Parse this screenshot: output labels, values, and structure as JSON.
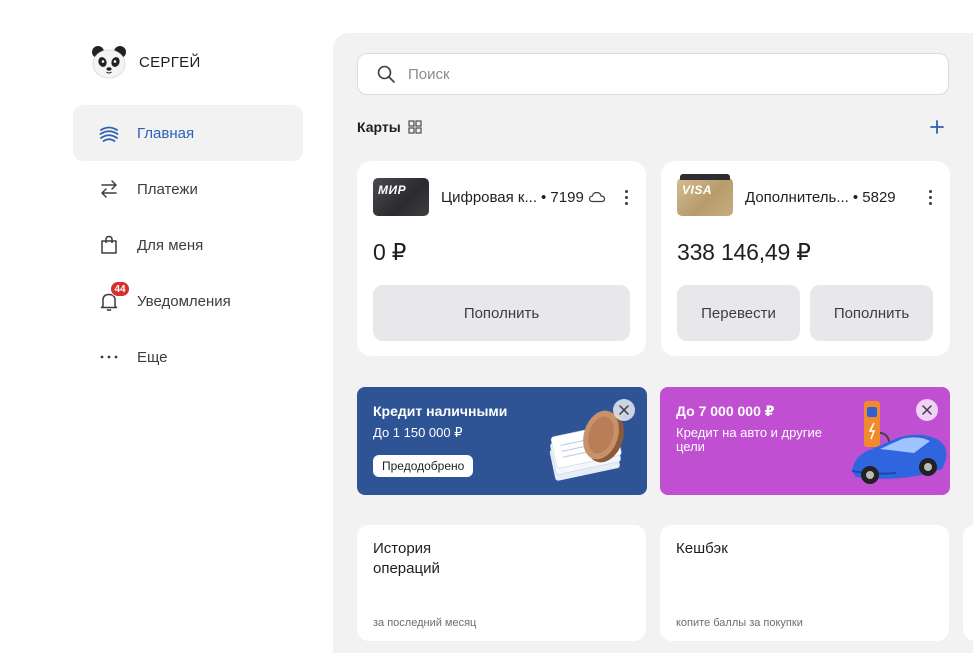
{
  "profile": {
    "name": "СЕРГЕЙ"
  },
  "nav": {
    "items": [
      {
        "label": "Главная",
        "icon": "home-globe-icon",
        "active": true
      },
      {
        "label": "Платежи",
        "icon": "transfer-arrows-icon"
      },
      {
        "label": "Для меня",
        "icon": "shopping-bag-icon"
      },
      {
        "label": "Уведомления",
        "icon": "bell-icon",
        "badge": "44"
      },
      {
        "label": "Еще",
        "icon": "more-dots-icon"
      }
    ]
  },
  "search": {
    "placeholder": "Поиск",
    "value": ""
  },
  "cards_section": {
    "title": "Карты"
  },
  "cards": [
    {
      "logo": "МИР",
      "name": "Цифровая к...",
      "number": "• 7199",
      "balance": "0 ₽",
      "actions": [
        "Пополнить"
      ]
    },
    {
      "logo": "VISA",
      "name": "Дополнитель...",
      "number": "• 5829",
      "balance": "338 146,49 ₽",
      "actions": [
        "Перевести",
        "Пополнить"
      ]
    }
  ],
  "promos": [
    {
      "title": "Кредит наличными",
      "subtitle": "До 1 150 000 ₽",
      "tag": "Предодобрено",
      "color": "#2f5495"
    },
    {
      "title": "До 7 000 000 ₽",
      "subtitle": "Кредит на авто и другие цели",
      "color": "#c04fd1"
    }
  ],
  "tiles": [
    {
      "title": "История\nопераций",
      "subtitle": "за последний месяц"
    },
    {
      "title": "Кешбэк",
      "subtitle": "копите баллы за покупки"
    }
  ],
  "colors": {
    "accent": "#2f5fb3",
    "badge": "#d6302b",
    "background": "#f2f2f3"
  }
}
